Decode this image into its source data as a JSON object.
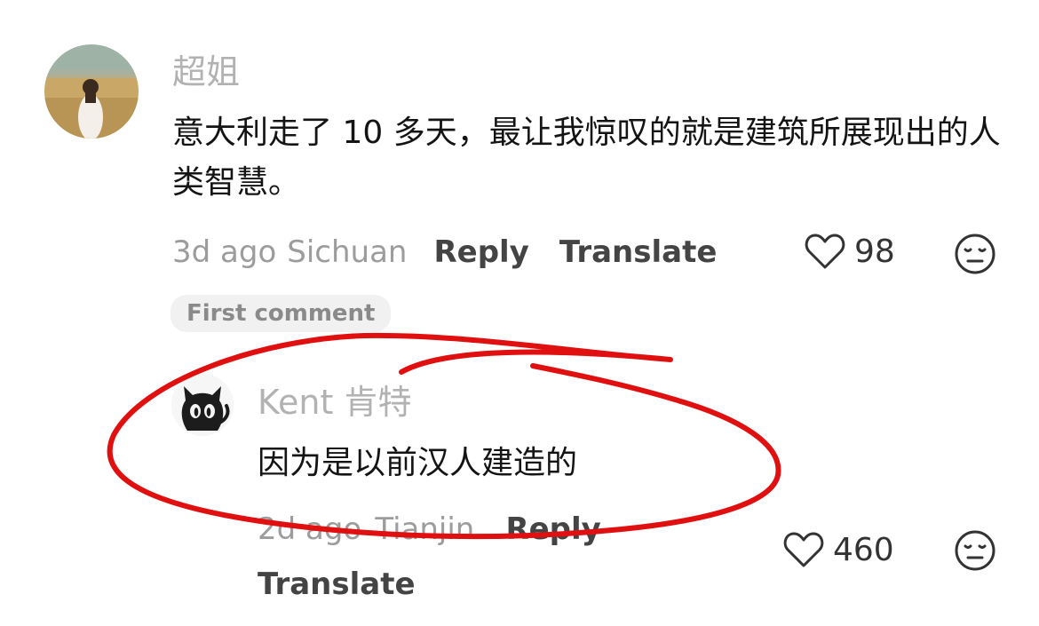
{
  "comments": [
    {
      "username": "超姐",
      "text": "意大利走了 10 多天，最让我惊叹的就是建筑所展现出的人类智慧。",
      "time": "3d ago",
      "location": "Sichuan",
      "reply_label": "Reply",
      "translate_label": "Translate",
      "likes": "98",
      "badge": "First comment",
      "replies": [
        {
          "username": "Kent 肯特",
          "text": "因为是以前汉人建造的",
          "time": "2d ago",
          "location": "Tianjin",
          "reply_label": "Reply",
          "translate_label": "Translate",
          "likes": "460"
        }
      ]
    }
  ],
  "colors": {
    "annotation": "#e01010",
    "icon": "#333333"
  },
  "icons": {
    "like": "heart-outline-icon",
    "dislike": "expressionless-face-icon"
  }
}
